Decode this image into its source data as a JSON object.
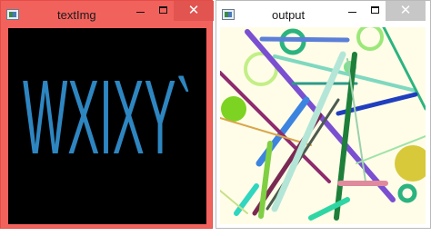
{
  "windows": {
    "textimg": {
      "title": "textImg",
      "text": "WXIXY`",
      "background_color": "#000000",
      "text_color": "#2e86c1"
    },
    "output": {
      "title": "output",
      "background_color": "#fffde8"
    }
  },
  "controls": {
    "minimize_icon": "minimize-icon",
    "maximize_icon": "maximize-icon",
    "close_glyph": "✕"
  }
}
